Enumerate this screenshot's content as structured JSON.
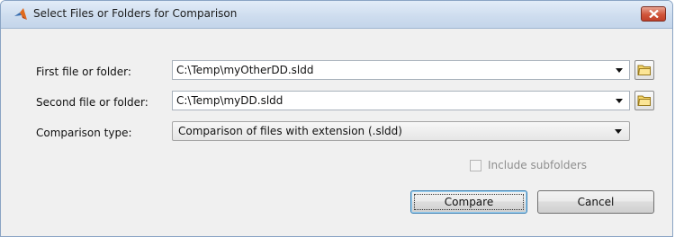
{
  "window": {
    "title": "Select Files or Folders for Comparison",
    "close_label": "×"
  },
  "first": {
    "label": "First file or folder:",
    "value": "C:\\Temp\\myOtherDD.sldd"
  },
  "second": {
    "label": "Second file or folder:",
    "value": "C:\\Temp\\myDD.sldd"
  },
  "comparison": {
    "label": "Comparison type:",
    "value": "Comparison of files with extension (.sldd)"
  },
  "subfolders": {
    "label": "Include subfolders",
    "checked": false,
    "enabled": false
  },
  "buttons": {
    "compare": "Compare",
    "cancel": "Cancel"
  },
  "icons": {
    "app": "matlab-logo-icon",
    "browse": "folder-icon",
    "dropdown": "chevron-down-icon",
    "close": "close-icon"
  },
  "colors": {
    "titlebar": "#cddcee",
    "close_button": "#d0553a",
    "dialog_bg": "#f0f0f0",
    "default_button_border": "#3c7fb1"
  }
}
